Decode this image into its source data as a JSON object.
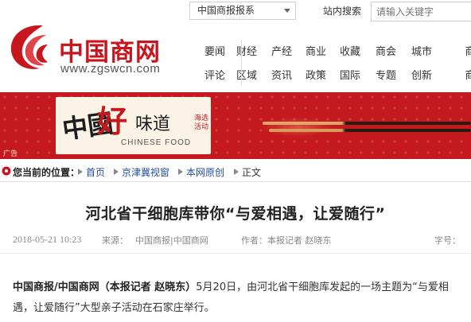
{
  "header": {
    "logo_text": "中国商网",
    "logo_url": "www.zgswcn.com",
    "site_select": "中国商报报系",
    "search_label": "站内搜索",
    "search_placeholder": "请输入关键字",
    "brand_color": "#c8161e"
  },
  "nav": {
    "row1": [
      "要闻",
      "财经",
      "产经",
      "商业",
      "收藏",
      "商会",
      "城市",
      "商"
    ],
    "row2": [
      "评论",
      "区域",
      "资讯",
      "政策",
      "国际",
      "专题",
      "创新",
      "商"
    ]
  },
  "banner": {
    "cn_part1": "中國",
    "cn_part2": "好",
    "cn_part3": "味道",
    "tag_line1": "海选",
    "tag_line2": "活动",
    "en_text": "CHINESE FOOD",
    "ad_label": "广告",
    "bg_color": "#c41a1f"
  },
  "breadcrumb": {
    "label": "您当前的位置：",
    "items": [
      "首页",
      "京津冀视窗",
      "本网原创",
      "正文"
    ]
  },
  "article": {
    "title": "河北省干细胞库带你“与爱相遇，让爱随行”",
    "date": "2018-05-21 10:23",
    "source_label": "来源：",
    "source": "中国商报|中国商网",
    "author": "作者：本报记者 赵晓东",
    "font_label": "字号：",
    "lead": "中国商报/中国商网（本报记者 赵晓东）",
    "body": "5月20日，由河北省干细胞库发起的一场主题为“与爱相遇，让爱随行”大型亲子活动在石家庄举行。"
  }
}
